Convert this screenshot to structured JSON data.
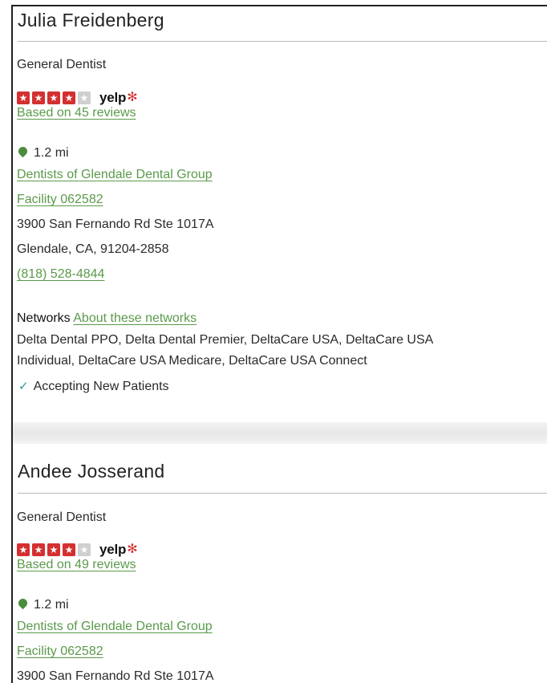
{
  "providers": [
    {
      "name": "Julia Freidenberg",
      "specialty": "General Dentist",
      "rating": 4,
      "rating_max": 5,
      "rating_source": "yelp",
      "reviews_text": "Based on 45 reviews",
      "distance": "1.2 mi",
      "practice": "Dentists of Glendale Dental Group",
      "facility": "Facility 062582",
      "address1": "3900 San Fernando Rd Ste 1017A",
      "address2": "Glendale, CA, 91204-2858",
      "phone": "(818) 528-4844",
      "networks_label": "Networks",
      "networks_link": "About these networks",
      "networks_line1": "Delta Dental PPO, Delta Dental Premier, DeltaCare USA, DeltaCare USA",
      "networks_line2": "Individual, DeltaCare USA Medicare, DeltaCare USA Connect",
      "accepting": "Accepting New Patients"
    },
    {
      "name": "Andee Josserand",
      "specialty": "General Dentist",
      "rating": 4,
      "rating_max": 5,
      "rating_source": "yelp",
      "reviews_text": "Based on 49 reviews",
      "distance": "1.2 mi",
      "practice": "Dentists of Glendale Dental Group",
      "facility": "Facility 062582",
      "address1": "3900 San Fernando Rd Ste 1017A"
    }
  ],
  "colors": {
    "link": "#5a9a4a",
    "star_on": "#d3302f",
    "star_off": "#cfcfcf",
    "pin": "#4a8c3b",
    "check": "#2a9a9c"
  }
}
